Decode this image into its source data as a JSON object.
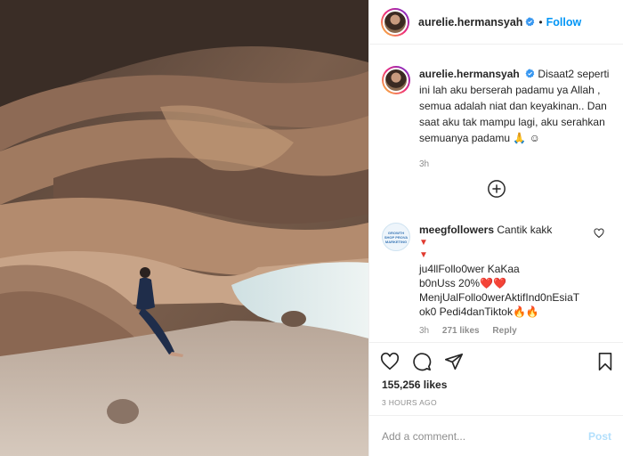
{
  "header": {
    "username": "aurelie.hermansyah",
    "dot": "•",
    "follow_label": "Follow"
  },
  "caption": {
    "username": "aurelie.hermansyah",
    "text": "Disaat2 seperti ini lah aku berserah padamu ya Allah , semua adalah niat dan keyakinan.. Dan saat aku tak mampu lagi, aku serahkan semuanya padamu 🙏 ☺",
    "time": "3h"
  },
  "comment": {
    "avatar_text": "GROWTH SHOP PROVA MARKETING",
    "username": "meegfollowers",
    "text_first": "Cantik kakk",
    "lines": [
      "ju4llFollo0wer KaKaa",
      "b0nUss 20%❤️❤️",
      "MenjUalFollo0werAktifInd0nEsiaT",
      "ok0 Pedi4danTiktok🔥🔥"
    ],
    "triangle": "▼",
    "time": "3h",
    "likes": "271 likes",
    "reply": "Reply"
  },
  "actions": {
    "likes_count": "155,256 likes",
    "posted": "3 HOURS AGO"
  },
  "add_comment": {
    "placeholder": "Add a comment...",
    "post_label": "Post"
  },
  "colors": {
    "accent": "#0095f6",
    "verified": "#3897f0",
    "muted": "#8e8e8e"
  },
  "icons": [
    "verified-badge-icon",
    "add-circle-icon",
    "heart-icon",
    "comment-icon",
    "share-icon",
    "bookmark-icon"
  ]
}
